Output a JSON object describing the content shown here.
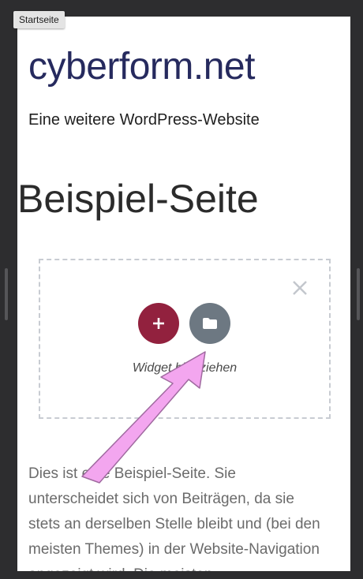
{
  "breadcrumb": {
    "label": "Startseite"
  },
  "site": {
    "title": "cyberform.net",
    "tagline": "Eine weitere WordPress-Website"
  },
  "page": {
    "heading": "Beispiel-Seite"
  },
  "dropzone": {
    "hint": "Widget hier ziehen",
    "add_icon": "plus-icon",
    "template_icon": "folder-icon",
    "close_icon": "close-icon",
    "add_color": "#92213e",
    "template_color": "#6d7882"
  },
  "content": {
    "paragraph": "Dies ist eine Beispiel-Seite. Sie unterscheidet sich von Beiträgen, da sie stets an derselben Stelle bleibt und (bei den meisten Themes) in der Website-Navigation angezeigt wird. Die meisten"
  },
  "annotation": {
    "arrow_color": "#f3a6ef"
  }
}
